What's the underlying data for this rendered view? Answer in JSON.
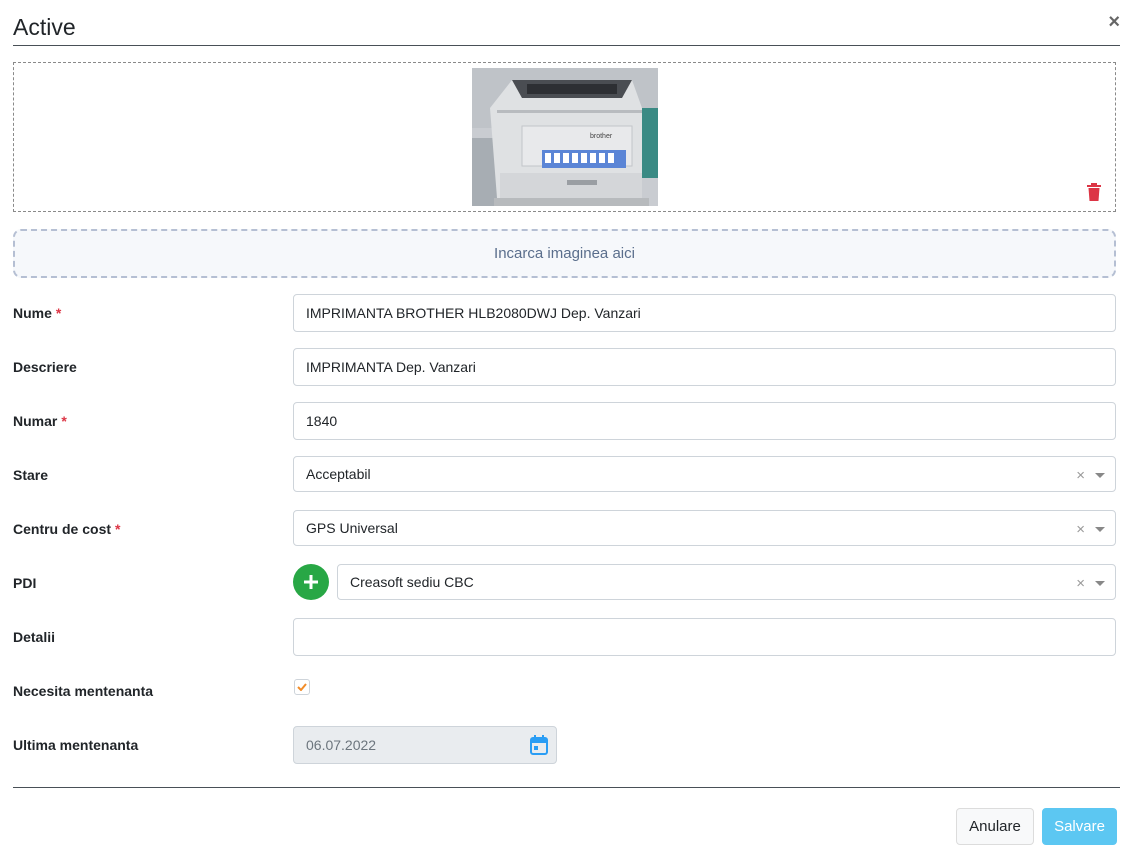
{
  "modal": {
    "title": "Active",
    "close_label": "×"
  },
  "image": {
    "printer_brand": "brother",
    "delete_icon": "trash-icon",
    "delete_color": "#dc3545"
  },
  "upload": {
    "label": "Incarca imaginea aici"
  },
  "form": {
    "nume": {
      "label": "Nume",
      "required": "*",
      "value": "IMPRIMANTA BROTHER HLB2080DWJ Dep. Vanzari"
    },
    "descriere": {
      "label": "Descriere",
      "value": "IMPRIMANTA Dep. Vanzari"
    },
    "numar": {
      "label": "Numar",
      "required": "*",
      "value": "1840"
    },
    "stare": {
      "label": "Stare",
      "value": "Acceptabil",
      "clear": "×"
    },
    "centru_cost": {
      "label": "Centru de cost",
      "required": "*",
      "value": "GPS Universal",
      "clear": "×"
    },
    "pdi": {
      "label": "PDI",
      "value": "Creasoft sediu CBC",
      "clear": "×",
      "add_icon": "plus-icon"
    },
    "detalii": {
      "label": "Detalii",
      "value": ""
    },
    "necesita_mentenanta": {
      "label": "Necesita mentenanta",
      "checked": true
    },
    "ultima_mentenanta": {
      "label": "Ultima mentenanta",
      "value": "06.07.2022",
      "icon": "calendar-icon"
    }
  },
  "footer": {
    "cancel_label": "Anulare",
    "save_label": "Salvare"
  },
  "colors": {
    "required": "#dc3545",
    "add_button": "#28a745",
    "save_button": "#5cc7f2",
    "checkbox_check": "#f28c28",
    "calendar": "#2a9df4"
  }
}
